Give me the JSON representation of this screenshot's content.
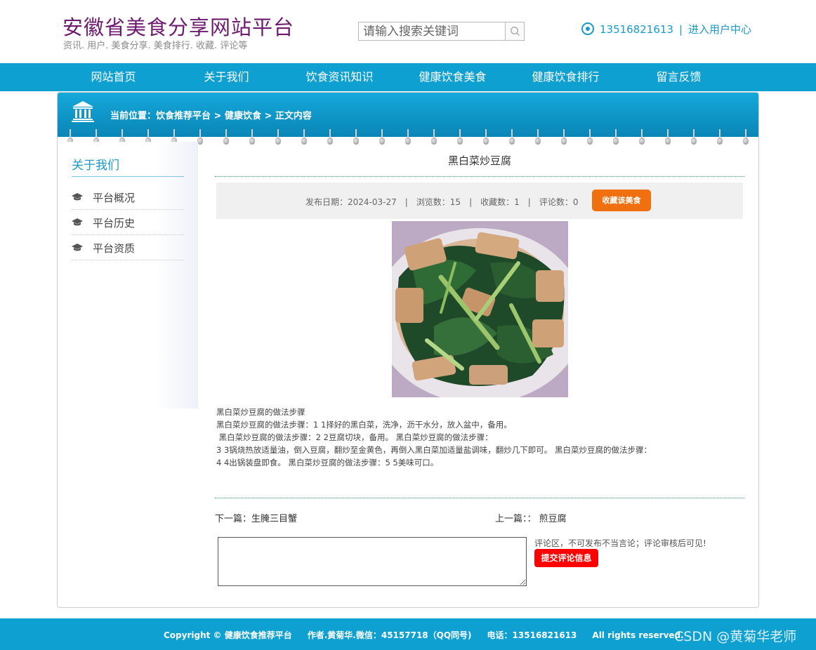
{
  "header": {
    "title": "安徽省美食分享网站平台",
    "subtitle": "资讯. 用户. 美食分享. 美食排行. 收藏. 评论等",
    "search_placeholder": "请输入搜索关键词",
    "phone": "13516821613",
    "separator": "|",
    "user_center": "进入用户中心"
  },
  "nav": {
    "items": [
      {
        "label": "网站首页"
      },
      {
        "label": "关于我们"
      },
      {
        "label": "饮食资讯知识"
      },
      {
        "label": "健康饮食美食"
      },
      {
        "label": "健康饮食排行"
      },
      {
        "label": "留言反馈"
      }
    ]
  },
  "breadcrumb": {
    "text": "当前位置：饮食推荐平台 > 健康饮食 > 正文内容"
  },
  "sidebar": {
    "title": "关于我们",
    "items": [
      {
        "label": "平台概况"
      },
      {
        "label": "平台历史"
      },
      {
        "label": "平台资质"
      }
    ]
  },
  "article": {
    "title": "黑白菜炒豆腐",
    "meta": {
      "date": "发布日期：2024-03-27",
      "views": "浏览数：15",
      "favorites": "收藏数：1",
      "comments": "评论数：0",
      "separator": "|"
    },
    "favorite_button": "收藏该美食",
    "body_lines": [
      "黑白菜炒豆腐的做法步骤",
      "黑白菜炒豆腐的做法步骤：1 1择好的黑白菜，洗净，沥干水分，放入盆中，备用。",
      " 黑白菜炒豆腐的做法步骤：2 2豆腐切块，备用。 黑白菜炒豆腐的做法步骤：",
      "3 3锅烧热放适量油，倒入豆腐，翻炒至金黄色，再倒入黑白菜加适量盐调味，翻炒几下即可。 黑白菜炒豆腐的做法步骤：",
      "4 4出锅装盘即食。 黑白菜炒豆腐的做法步骤：5 5美味可口。"
    ],
    "next": "下一篇：生腌三目蟹",
    "prev": "上一篇：： 煎豆腐"
  },
  "comment": {
    "value": "",
    "note": "评论区，不可发布不当言论；评论审核后可见!",
    "submit": "提交评论信息"
  },
  "footer": {
    "copyright": "Copyright © 健康饮食推荐平台",
    "author": "作者.黄菊华.微信：45157718（QQ同号)",
    "phone": "电话：13516821613",
    "rights": "All rights reserved."
  },
  "watermark": "CSDN @黄菊华老师",
  "colors": {
    "brand_blue": "#0fa0d2",
    "title_purple": "#6d1a6f",
    "accent_orange": "#f07010",
    "submit_red": "#ff0000"
  }
}
